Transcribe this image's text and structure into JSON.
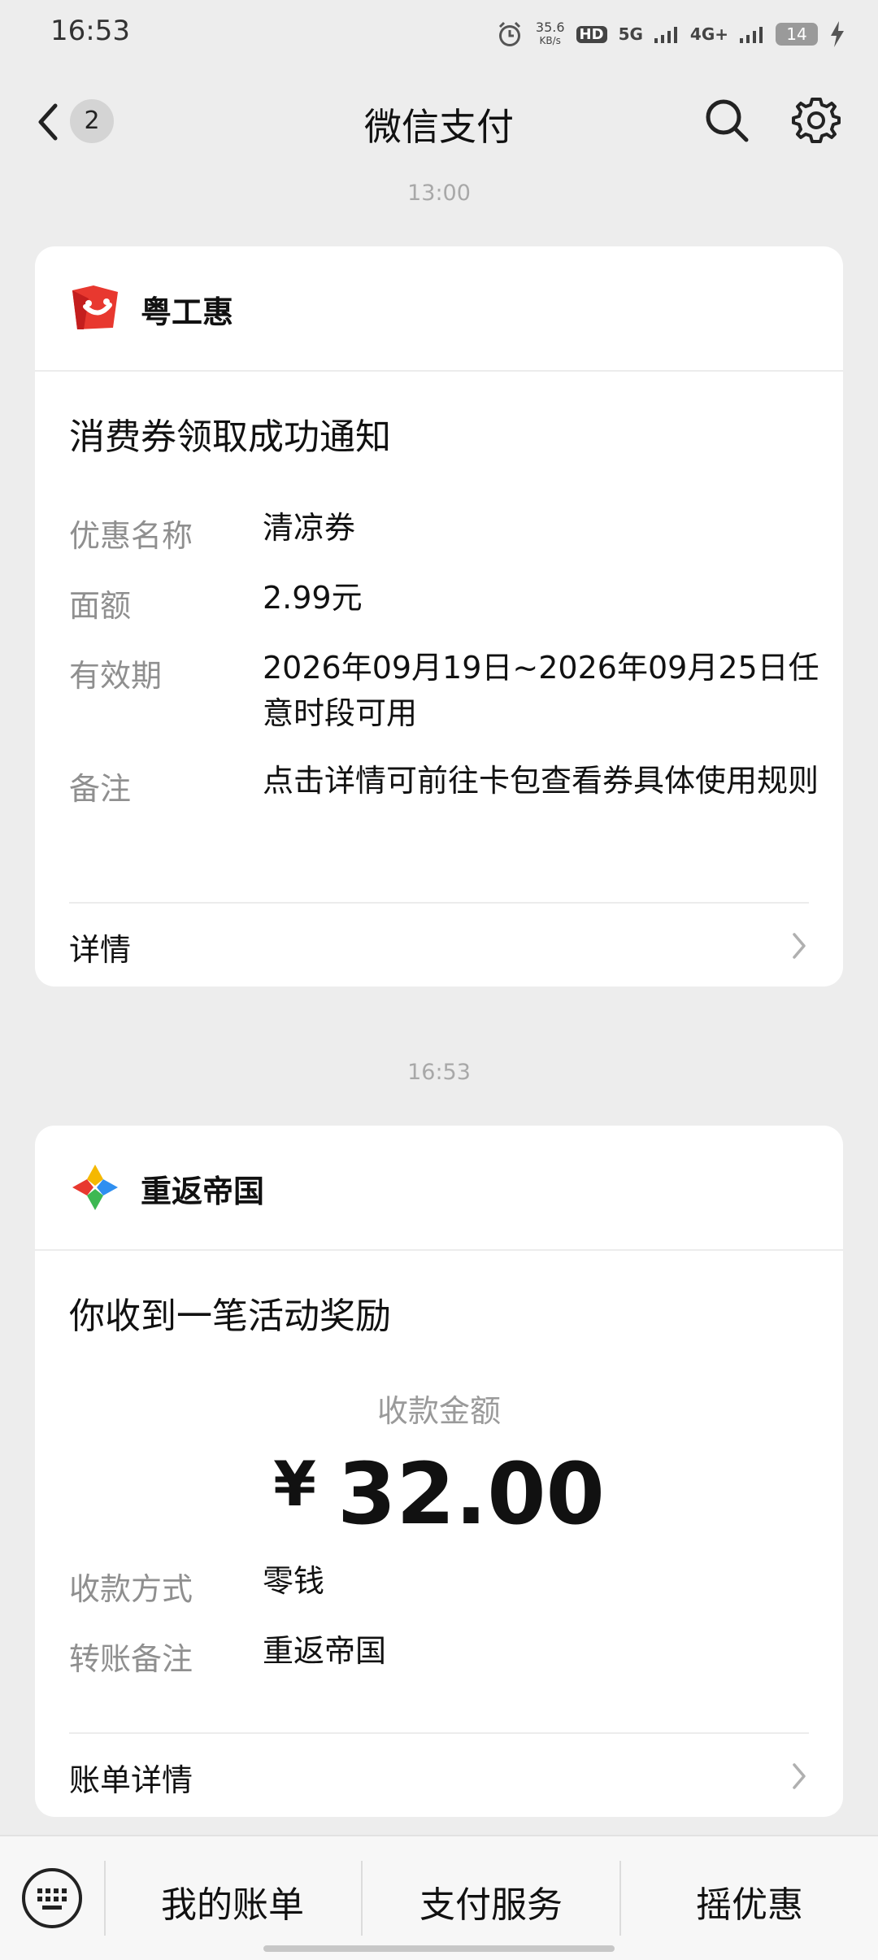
{
  "status_bar": {
    "time": "16:53",
    "speed_value": "35.6",
    "speed_unit": "KB/s",
    "hd_label": "HD",
    "net_5g": "5G",
    "net_4g": "4G+",
    "battery": "14"
  },
  "header": {
    "title": "微信支付",
    "unread_badge": "2"
  },
  "messages": [
    {
      "time": "13:00",
      "brand": "粤工惠",
      "title": "消费券领取成功通知",
      "fields": [
        {
          "label": "优惠名称",
          "value": "清凉券"
        },
        {
          "label": "面额",
          "value": "2.99元"
        },
        {
          "label": "有效期",
          "value": "2026年09月19日~2026年09月25日任意时段可用"
        },
        {
          "label": "备注",
          "value": "点击详情可前往卡包查看券具体使用规则"
        }
      ],
      "link_label": "详情"
    },
    {
      "time": "16:53",
      "brand": "重返帝国",
      "title": "你收到一笔活动奖励",
      "amount_label": "收款金额",
      "currency": "¥",
      "amount": "32.00",
      "fields": [
        {
          "label": "收款方式",
          "value": "零钱"
        },
        {
          "label": "转账备注",
          "value": "重返帝国"
        }
      ],
      "link_label": "账单详情"
    }
  ],
  "bottom_menu": [
    "我的账单",
    "支付服务",
    "摇优惠"
  ],
  "colors": {
    "background": "#ededed",
    "card": "#ffffff",
    "label_gray": "#8f8f8f",
    "brand1_red": "#e8382f",
    "brand2_blue": "#2f8ff0",
    "brand2_green": "#3db853",
    "brand2_yellow": "#f5b800"
  }
}
